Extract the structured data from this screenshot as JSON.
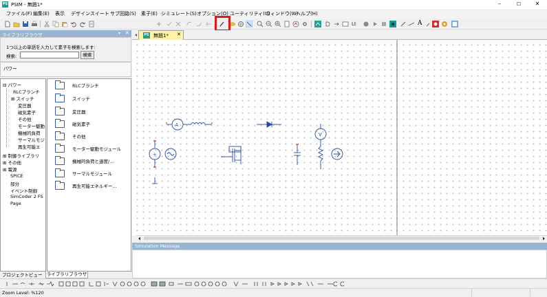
{
  "window": {
    "app_icon_text": "PS",
    "title": "PSIM - 無題1*",
    "minimize": "–",
    "maximize": "☐",
    "close": "✕"
  },
  "menu": [
    "ファイル(F)",
    "編集(E)",
    "表示",
    "デザインスイート",
    "サブ回路(S)",
    "素子(E)",
    "シミュレート(S)",
    "オプション(O)",
    "ユーティリティ(U)",
    "ウィンドウ(W)",
    "ヘルプ(H)"
  ],
  "toolbar": {
    "text_tool": "A",
    "line_tool": "Lt"
  },
  "library": {
    "header": "ライブラリブラウザ",
    "pin_icon": "▾",
    "close_icon": "✕",
    "search_hint": "1つ以上の単語を入力して素子を検索します:",
    "search_label": "検索:",
    "search_value": "",
    "search_button": "検索",
    "category_title": "パワー",
    "tree": [
      {
        "prefix": "⊟",
        "label": "パワー",
        "indent": 0
      },
      {
        "prefix": "",
        "label": "RLCブランチ",
        "indent": 1
      },
      {
        "prefix": "⊞",
        "label": "スイッチ",
        "indent": 1
      },
      {
        "prefix": "",
        "label": "変圧器",
        "indent": 1
      },
      {
        "prefix": "",
        "label": "磁気素子",
        "indent": 1
      },
      {
        "prefix": "",
        "label": "その他",
        "indent": 1
      },
      {
        "prefix": "",
        "label": "モーター駆動",
        "indent": 1
      },
      {
        "prefix": "",
        "label": "機械的負荷",
        "indent": 1
      },
      {
        "prefix": "",
        "label": "サーマルモジ",
        "indent": 1
      },
      {
        "prefix": "",
        "label": "再生可能エ",
        "indent": 1
      },
      {
        "prefix": "⊞",
        "label": "制御ライブラリ",
        "indent": 0
      },
      {
        "prefix": "⊞",
        "label": "その他",
        "indent": 0
      },
      {
        "prefix": "⊞",
        "label": "電源",
        "indent": 0
      },
      {
        "prefix": "",
        "label": "SPICE",
        "indent": 0
      },
      {
        "prefix": "",
        "label": "部分",
        "indent": 0
      },
      {
        "prefix": "",
        "label": "イベント制御",
        "indent": 0
      },
      {
        "prefix": "",
        "label": "SimCoder 2 FS",
        "indent": 0
      },
      {
        "prefix": "",
        "label": "Page",
        "indent": 0
      }
    ],
    "folders": [
      "RLCブランチ",
      "スイッチ",
      "変圧器",
      "磁気素子",
      "その他",
      "モーター駆動モジュール",
      "機械的負荷と速度/...",
      "サーマルモジュール",
      "再生可能エネルギー..."
    ],
    "bottom_tabs": [
      "プロジェクトビュー",
      "ライブラリブラウザ"
    ]
  },
  "document": {
    "tab_icon": "PS",
    "tab_label": "無題1*",
    "tab_close": "✕"
  },
  "simulation": {
    "header": "Simulation Message"
  },
  "status": {
    "zoom": "Zoom Level: %120"
  }
}
